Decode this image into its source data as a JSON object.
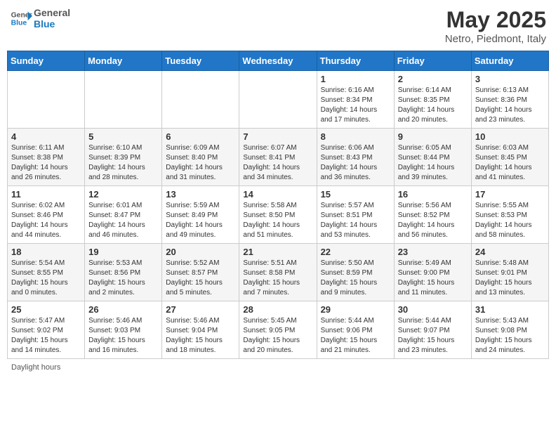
{
  "header": {
    "logo_general": "General",
    "logo_blue": "Blue",
    "month_year": "May 2025",
    "location": "Netro, Piedmont, Italy"
  },
  "days_of_week": [
    "Sunday",
    "Monday",
    "Tuesday",
    "Wednesday",
    "Thursday",
    "Friday",
    "Saturday"
  ],
  "weeks": [
    [
      {
        "day": "",
        "info": ""
      },
      {
        "day": "",
        "info": ""
      },
      {
        "day": "",
        "info": ""
      },
      {
        "day": "",
        "info": ""
      },
      {
        "day": "1",
        "info": "Sunrise: 6:16 AM\nSunset: 8:34 PM\nDaylight: 14 hours\nand 17 minutes."
      },
      {
        "day": "2",
        "info": "Sunrise: 6:14 AM\nSunset: 8:35 PM\nDaylight: 14 hours\nand 20 minutes."
      },
      {
        "day": "3",
        "info": "Sunrise: 6:13 AM\nSunset: 8:36 PM\nDaylight: 14 hours\nand 23 minutes."
      }
    ],
    [
      {
        "day": "4",
        "info": "Sunrise: 6:11 AM\nSunset: 8:38 PM\nDaylight: 14 hours\nand 26 minutes."
      },
      {
        "day": "5",
        "info": "Sunrise: 6:10 AM\nSunset: 8:39 PM\nDaylight: 14 hours\nand 28 minutes."
      },
      {
        "day": "6",
        "info": "Sunrise: 6:09 AM\nSunset: 8:40 PM\nDaylight: 14 hours\nand 31 minutes."
      },
      {
        "day": "7",
        "info": "Sunrise: 6:07 AM\nSunset: 8:41 PM\nDaylight: 14 hours\nand 34 minutes."
      },
      {
        "day": "8",
        "info": "Sunrise: 6:06 AM\nSunset: 8:43 PM\nDaylight: 14 hours\nand 36 minutes."
      },
      {
        "day": "9",
        "info": "Sunrise: 6:05 AM\nSunset: 8:44 PM\nDaylight: 14 hours\nand 39 minutes."
      },
      {
        "day": "10",
        "info": "Sunrise: 6:03 AM\nSunset: 8:45 PM\nDaylight: 14 hours\nand 41 minutes."
      }
    ],
    [
      {
        "day": "11",
        "info": "Sunrise: 6:02 AM\nSunset: 8:46 PM\nDaylight: 14 hours\nand 44 minutes."
      },
      {
        "day": "12",
        "info": "Sunrise: 6:01 AM\nSunset: 8:47 PM\nDaylight: 14 hours\nand 46 minutes."
      },
      {
        "day": "13",
        "info": "Sunrise: 5:59 AM\nSunset: 8:49 PM\nDaylight: 14 hours\nand 49 minutes."
      },
      {
        "day": "14",
        "info": "Sunrise: 5:58 AM\nSunset: 8:50 PM\nDaylight: 14 hours\nand 51 minutes."
      },
      {
        "day": "15",
        "info": "Sunrise: 5:57 AM\nSunset: 8:51 PM\nDaylight: 14 hours\nand 53 minutes."
      },
      {
        "day": "16",
        "info": "Sunrise: 5:56 AM\nSunset: 8:52 PM\nDaylight: 14 hours\nand 56 minutes."
      },
      {
        "day": "17",
        "info": "Sunrise: 5:55 AM\nSunset: 8:53 PM\nDaylight: 14 hours\nand 58 minutes."
      }
    ],
    [
      {
        "day": "18",
        "info": "Sunrise: 5:54 AM\nSunset: 8:55 PM\nDaylight: 15 hours\nand 0 minutes."
      },
      {
        "day": "19",
        "info": "Sunrise: 5:53 AM\nSunset: 8:56 PM\nDaylight: 15 hours\nand 2 minutes."
      },
      {
        "day": "20",
        "info": "Sunrise: 5:52 AM\nSunset: 8:57 PM\nDaylight: 15 hours\nand 5 minutes."
      },
      {
        "day": "21",
        "info": "Sunrise: 5:51 AM\nSunset: 8:58 PM\nDaylight: 15 hours\nand 7 minutes."
      },
      {
        "day": "22",
        "info": "Sunrise: 5:50 AM\nSunset: 8:59 PM\nDaylight: 15 hours\nand 9 minutes."
      },
      {
        "day": "23",
        "info": "Sunrise: 5:49 AM\nSunset: 9:00 PM\nDaylight: 15 hours\nand 11 minutes."
      },
      {
        "day": "24",
        "info": "Sunrise: 5:48 AM\nSunset: 9:01 PM\nDaylight: 15 hours\nand 13 minutes."
      }
    ],
    [
      {
        "day": "25",
        "info": "Sunrise: 5:47 AM\nSunset: 9:02 PM\nDaylight: 15 hours\nand 14 minutes."
      },
      {
        "day": "26",
        "info": "Sunrise: 5:46 AM\nSunset: 9:03 PM\nDaylight: 15 hours\nand 16 minutes."
      },
      {
        "day": "27",
        "info": "Sunrise: 5:46 AM\nSunset: 9:04 PM\nDaylight: 15 hours\nand 18 minutes."
      },
      {
        "day": "28",
        "info": "Sunrise: 5:45 AM\nSunset: 9:05 PM\nDaylight: 15 hours\nand 20 minutes."
      },
      {
        "day": "29",
        "info": "Sunrise: 5:44 AM\nSunset: 9:06 PM\nDaylight: 15 hours\nand 21 minutes."
      },
      {
        "day": "30",
        "info": "Sunrise: 5:44 AM\nSunset: 9:07 PM\nDaylight: 15 hours\nand 23 minutes."
      },
      {
        "day": "31",
        "info": "Sunrise: 5:43 AM\nSunset: 9:08 PM\nDaylight: 15 hours\nand 24 minutes."
      }
    ]
  ],
  "legend": {
    "daylight_hours": "Daylight hours"
  }
}
